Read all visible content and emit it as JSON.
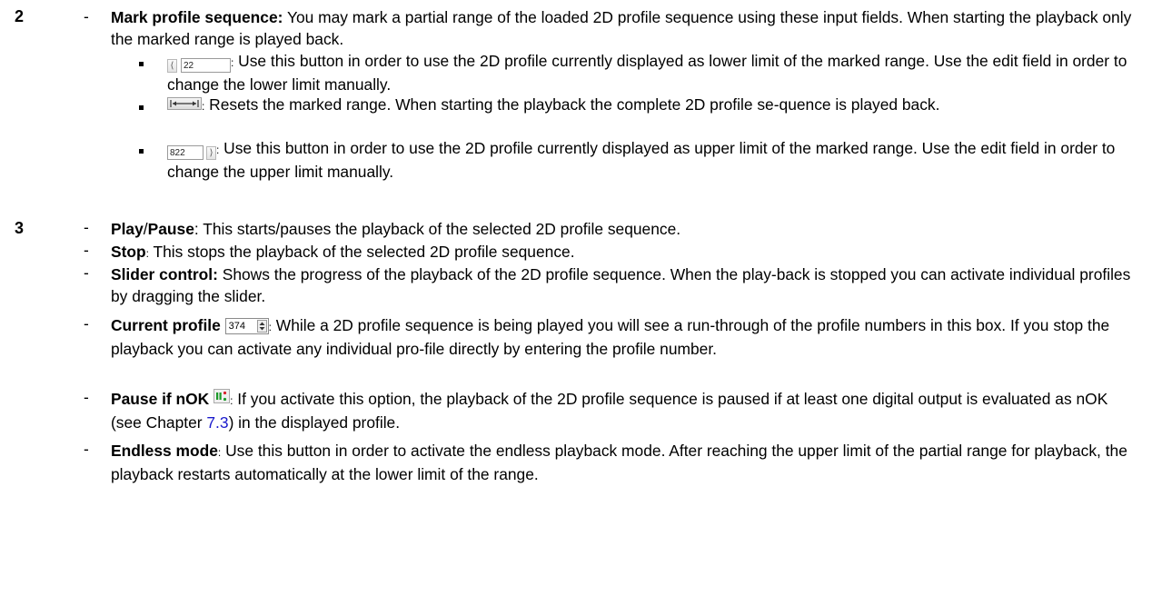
{
  "section2": {
    "number": "2",
    "dash": "-",
    "title": "Mark profile sequence:",
    "text": " You may mark a partial range of the loaded 2D profile sequence using these input fields. When starting the playback only the marked range is played back.",
    "bullets": [
      {
        "field_value": "22",
        "text": " Use this button in order to use the 2D profile currently displayed as lower limit of the marked range. Use the edit field in order to change the lower limit manually."
      },
      {
        "text": " Resets the marked range. When starting the playback the complete 2D profile se-quence is played back."
      },
      {
        "field_value": "822",
        "text": " Use this button in order to use the 2D profile currently displayed as upper limit of the marked range. Use the edit field in order to change the upper limit manually."
      }
    ]
  },
  "section3": {
    "number": "3",
    "dash": "-",
    "items": [
      {
        "title_a": "Play",
        "sep": "/",
        "title_b": "Pause",
        "text": ": This starts/pauses the playback of the selected 2D profile sequence."
      },
      {
        "title": "Stop",
        "text": " This stops the playback of the selected 2D profile sequence."
      },
      {
        "title": "Slider control:",
        "text": " Shows the progress of the playback of the 2D profile sequence. When the play-back is stopped you can activate individual profiles by dragging the slider."
      },
      {
        "title": "Current profile",
        "spin_value": "374",
        "text": " While a 2D profile sequence is being played you will see a run-through of the profile numbers in this box. If you stop the playback you can activate any individual pro-file directly by entering the profile number."
      },
      {
        "title": "Pause if nOK",
        "text_a": " If you activate this option, the playback of the 2D profile sequence is paused if at least one digital output is evaluated as nOK (see Chapter ",
        "link": "7.3",
        "text_b": ") in the displayed profile."
      },
      {
        "title": "Endless mode",
        "text": " Use this button in order to activate the endless playback mode. After reaching the upper limit of the partial range for playback, the playback restarts automatically at the lower limit of the range."
      }
    ]
  },
  "colon": ":",
  "colors": {
    "link": "#1a1acc",
    "nok_green": "#1c9a2a",
    "nok_red": "#d8202a"
  }
}
